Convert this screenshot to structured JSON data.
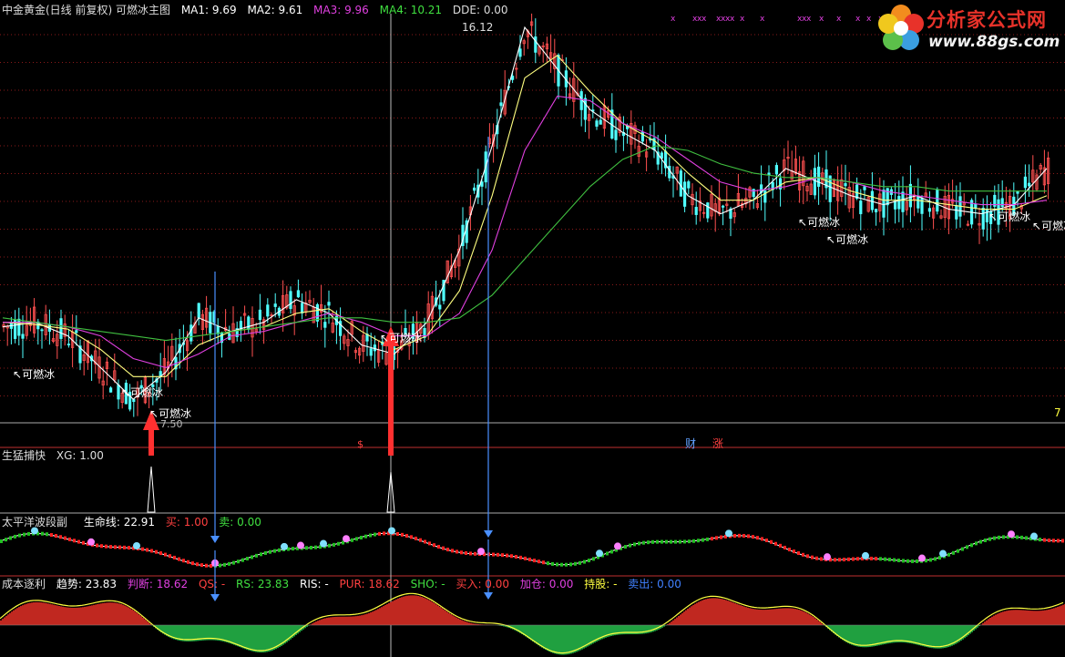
{
  "main": {
    "title": "中金黄金(日线 前复权) 可燃冰主图",
    "ma": [
      {
        "label": "MA1: 9.69",
        "color": "#ffffff"
      },
      {
        "label": "MA2: 9.61",
        "color": "#ffffff"
      },
      {
        "label": "MA3: 9.96",
        "color": "#e040e0"
      },
      {
        "label": "MA4: 10.21",
        "color": "#40e040"
      },
      {
        "label": "DDE: 0.00",
        "color": "#dddddd"
      }
    ],
    "peak_label": "16.12",
    "low_label": "7.50",
    "signal_label": "可燃冰",
    "right_axis_tag": "7",
    "markers": {
      "dollar": "$",
      "cai": "财",
      "zhang": "涨"
    }
  },
  "panel1": {
    "title": "生猛捕快",
    "value": "XG: 1.00"
  },
  "panel2": {
    "title": "太平洋波段副",
    "items": [
      {
        "label": "生命线: 22.91",
        "color": "#ffffff"
      },
      {
        "label": "买: 1.00",
        "color": "#ff4040"
      },
      {
        "label": "卖: 0.00",
        "color": "#40e040"
      }
    ]
  },
  "panel3": {
    "title": "成本逐利",
    "items": [
      {
        "label": "趋势: 23.83",
        "color": "#ffffff"
      },
      {
        "label": "判断: 18.62",
        "color": "#e040e0"
      },
      {
        "label": "QS: -",
        "color": "#ff4040"
      },
      {
        "label": "RS: 23.83",
        "color": "#40e040"
      },
      {
        "label": "RIS: -",
        "color": "#ffffff"
      },
      {
        "label": "PUR: 18.62",
        "color": "#ff4040"
      },
      {
        "label": "SHO: -",
        "color": "#40e040"
      },
      {
        "label": "买入: 0.00",
        "color": "#ff4040"
      },
      {
        "label": "加仓: 0.00",
        "color": "#e040e0"
      },
      {
        "label": "持股: -",
        "color": "#ffff40"
      },
      {
        "label": "卖出: 0.00",
        "color": "#4080ff"
      }
    ]
  },
  "logo": {
    "title": "分析家公式网",
    "url": "www.88gs.com"
  },
  "chart_data": {
    "type": "line",
    "price_range": [
      7.5,
      16.12
    ],
    "series": [
      {
        "values": [
          9.5,
          9.6,
          9.3,
          8.6,
          7.9,
          8.5,
          9.7,
          9.4,
          9.6,
          10.1,
          9.8,
          9.1,
          8.9,
          9.6,
          11.2,
          13.5,
          16.12,
          15.2,
          14.3,
          13.8,
          13.4,
          12.4,
          12.0,
          12.3,
          13.0,
          12.7,
          12.4,
          12.2,
          12.4,
          12.1,
          12.0,
          12.2,
          13.0
        ]
      },
      {
        "values": [
          9.6,
          9.55,
          9.45,
          9.0,
          8.4,
          8.4,
          9.1,
          9.4,
          9.5,
          9.8,
          9.9,
          9.4,
          9.0,
          9.3,
          10.3,
          12.4,
          15.0,
          15.5,
          14.7,
          14.0,
          13.6,
          12.9,
          12.3,
          12.3,
          12.7,
          12.8,
          12.5,
          12.3,
          12.3,
          12.2,
          12.1,
          12.1,
          12.4
        ]
      },
      {
        "values": [
          9.6,
          9.6,
          9.5,
          9.3,
          8.8,
          8.6,
          8.9,
          9.3,
          9.4,
          9.6,
          9.8,
          9.6,
          9.3,
          9.3,
          9.8,
          11.2,
          13.4,
          14.6,
          14.5,
          14.0,
          13.7,
          13.2,
          12.7,
          12.5,
          12.6,
          12.8,
          12.7,
          12.5,
          12.4,
          12.3,
          12.2,
          12.2,
          12.3
        ]
      },
      {
        "values": [
          9.7,
          9.6,
          9.5,
          9.4,
          9.3,
          9.2,
          9.3,
          9.4,
          9.5,
          9.6,
          9.7,
          9.7,
          9.6,
          9.6,
          9.7,
          10.2,
          11.0,
          11.8,
          12.6,
          13.2,
          13.5,
          13.4,
          13.1,
          12.9,
          12.8,
          12.8,
          12.7,
          12.6,
          12.6,
          12.5,
          12.5,
          12.5,
          12.5
        ]
      }
    ]
  }
}
